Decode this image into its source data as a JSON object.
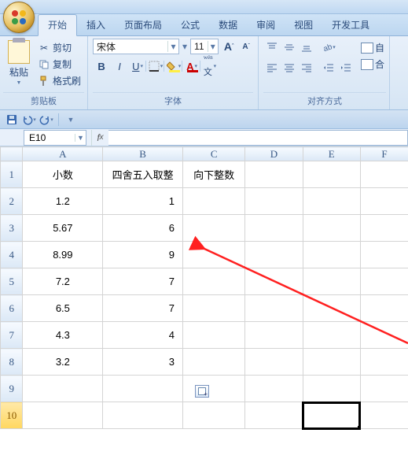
{
  "tabs": [
    "开始",
    "插入",
    "页面布局",
    "公式",
    "数据",
    "审阅",
    "视图",
    "开发工具"
  ],
  "activeTab": 0,
  "clipboard": {
    "group": "剪贴板",
    "paste": "粘贴",
    "cut": "剪切",
    "copy": "复制",
    "format": "格式刷"
  },
  "font": {
    "group": "字体",
    "name": "宋体",
    "size": "11"
  },
  "align": {
    "group": "对齐方式",
    "wrap": "自",
    "merge": "合"
  },
  "nameBox": "E10",
  "columns": [
    "A",
    "B",
    "C",
    "D",
    "E",
    "F"
  ],
  "rows": [
    {
      "n": "1",
      "a": "小数",
      "b": "四舍五入取整",
      "c": "向下整数",
      "balign": "center"
    },
    {
      "n": "2",
      "a": "1.2",
      "b": "1",
      "c": ""
    },
    {
      "n": "3",
      "a": "5.67",
      "b": "6",
      "c": ""
    },
    {
      "n": "4",
      "a": "8.99",
      "b": "9",
      "c": ""
    },
    {
      "n": "5",
      "a": "7.2",
      "b": "7",
      "c": ""
    },
    {
      "n": "6",
      "a": "6.5",
      "b": "7",
      "c": ""
    },
    {
      "n": "7",
      "a": "4.3",
      "b": "4",
      "c": ""
    },
    {
      "n": "8",
      "a": "3.2",
      "b": "3",
      "c": ""
    },
    {
      "n": "9",
      "a": "",
      "b": "",
      "c": ""
    },
    {
      "n": "10",
      "a": "",
      "b": "",
      "c": ""
    }
  ],
  "selectedRow": 10,
  "selectedCol": 4,
  "chart_data": {
    "type": "table",
    "title": "",
    "columns": [
      "小数",
      "四舍五入取整",
      "向下整数"
    ],
    "rows": [
      [
        1.2,
        1,
        null
      ],
      [
        5.67,
        6,
        null
      ],
      [
        8.99,
        9,
        null
      ],
      [
        7.2,
        7,
        null
      ],
      [
        6.5,
        7,
        null
      ],
      [
        4.3,
        4,
        null
      ],
      [
        3.2,
        3,
        null
      ]
    ]
  }
}
